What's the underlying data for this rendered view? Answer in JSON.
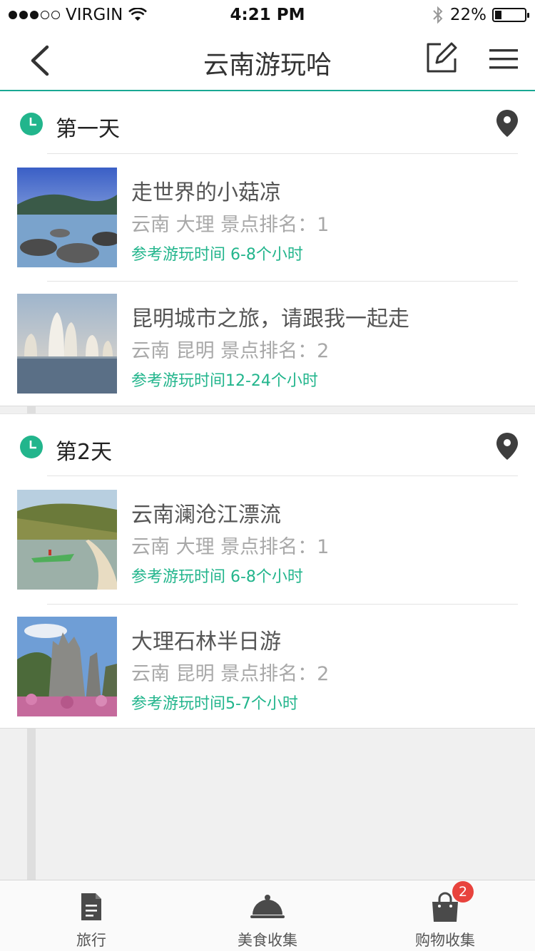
{
  "status_bar": {
    "carrier": "VIRGIN",
    "time": "4:21 PM",
    "battery": "22%",
    "battery_level": 0.22,
    "signal_bars_filled": 3,
    "signal_bars_total": 5
  },
  "nav": {
    "title": "云南游玩哈",
    "back_icon": "chevron-left-icon",
    "edit_icon": "edit-icon",
    "menu_icon": "hamburger-menu-icon"
  },
  "days": [
    {
      "label": "第一天",
      "items": [
        {
          "name": "走世界的小菇凉",
          "sub": "云南 大理 景点排名：1",
          "time": "参考游玩时间 6-8个小时"
        },
        {
          "name": "昆明城市之旅，请跟我一起走",
          "sub": "云南 昆明 景点排名：2",
          "time": "参考游玩时间12-24个小时"
        }
      ]
    },
    {
      "label": "第2天",
      "items": [
        {
          "name": "云南澜沧江漂流",
          "sub": "云南 大理 景点排名：1",
          "time": "参考游玩时间 6-8个小时"
        },
        {
          "name": "大理石林半日游",
          "sub": "云南 昆明 景点排名：2",
          "time": "参考游玩时间5-7个小时"
        }
      ]
    }
  ],
  "tabs": [
    {
      "label": "旅行",
      "icon": "document-icon"
    },
    {
      "label": "美食收集",
      "icon": "food-cloche-icon"
    },
    {
      "label": "购物收集",
      "icon": "shopping-bag-icon",
      "badge": "2"
    }
  ],
  "colors": {
    "accent": "#1aa893",
    "clock": "#22b58c",
    "badge": "#e8433d"
  }
}
